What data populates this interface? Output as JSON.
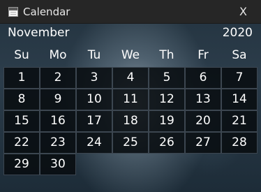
{
  "window": {
    "title": "Calendar",
    "icon": "calendar-icon",
    "close_label": "X"
  },
  "header": {
    "month": "November",
    "year": "2020"
  },
  "weekdays": [
    "Su",
    "Mo",
    "Tu",
    "We",
    "Th",
    "Fr",
    "Sa"
  ],
  "days": [
    "1",
    "2",
    "3",
    "4",
    "5",
    "6",
    "7",
    "8",
    "9",
    "10",
    "11",
    "12",
    "13",
    "14",
    "15",
    "16",
    "17",
    "18",
    "19",
    "20",
    "21",
    "22",
    "23",
    "24",
    "25",
    "26",
    "27",
    "28",
    "29",
    "30"
  ]
}
